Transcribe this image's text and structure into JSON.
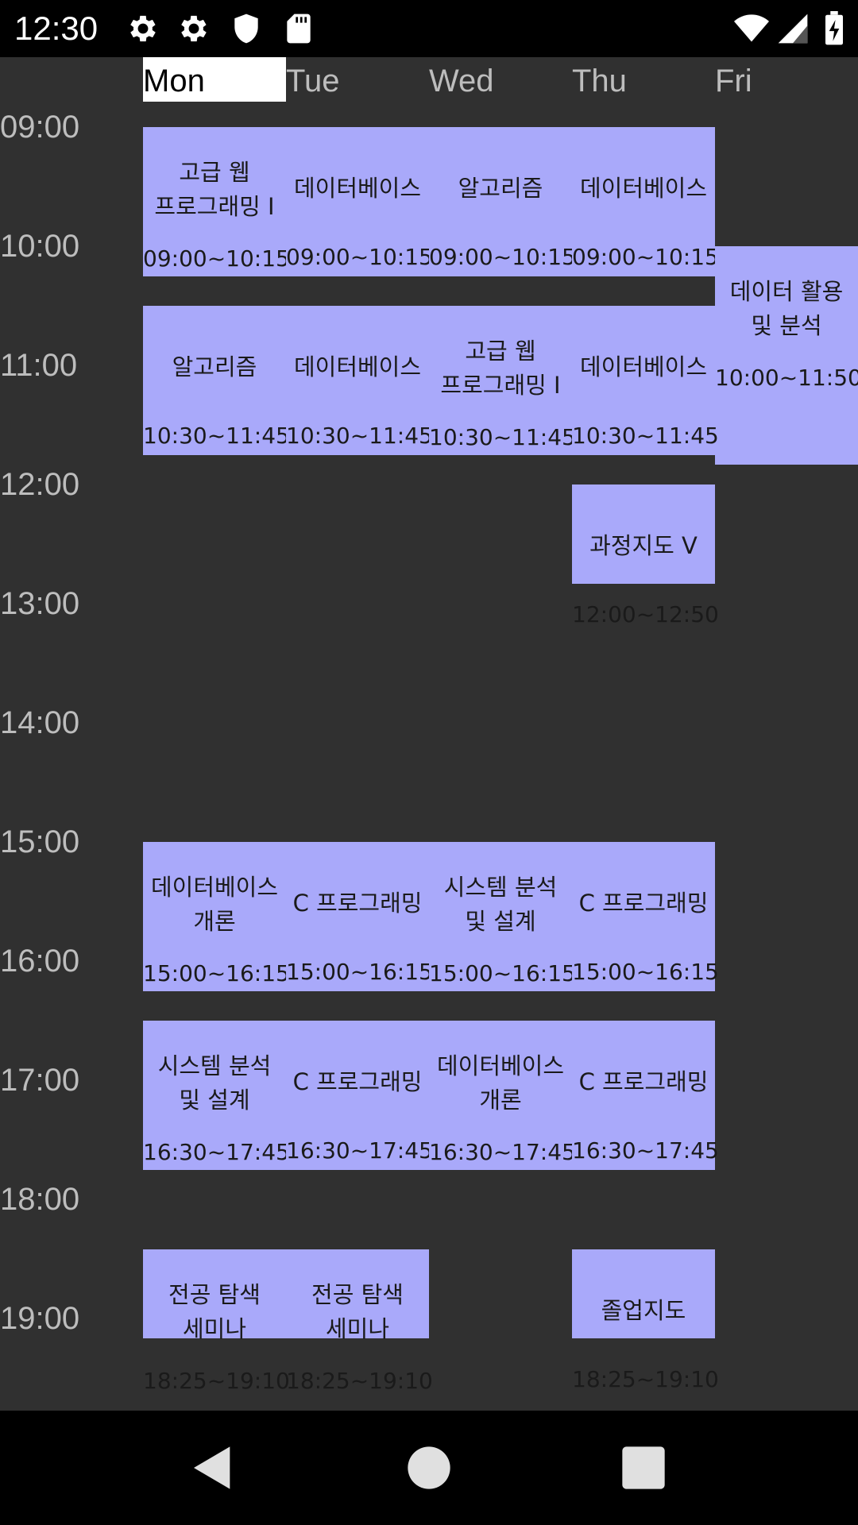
{
  "status_bar": {
    "time": "12:30",
    "left_icons": [
      "settings-icon",
      "settings-icon",
      "shield-icon",
      "sd-card-icon"
    ],
    "right_icons": [
      "wifi-icon",
      "cell-signal-icon",
      "battery-charging-icon"
    ]
  },
  "days": [
    "Mon",
    "Tue",
    "Wed",
    "Thu",
    "Fri"
  ],
  "selected_day": "Mon",
  "hours": [
    "09:00",
    "10:00",
    "11:00",
    "12:00",
    "13:00",
    "14:00",
    "15:00",
    "16:00",
    "17:00",
    "18:00",
    "19:00"
  ],
  "courses": [
    {
      "day": "Mon",
      "name": "고급 웹\n프로그래밍 I",
      "time": "09:00~10:15"
    },
    {
      "day": "Tue",
      "name": "데이터베이스",
      "time": "09:00~10:15"
    },
    {
      "day": "Wed",
      "name": "알고리즘",
      "time": "09:00~10:15"
    },
    {
      "day": "Thu",
      "name": "데이터베이스",
      "time": "09:00~10:15"
    },
    {
      "day": "Fri",
      "name": "데이터 활용\n및 분석",
      "time": "10:00~11:50"
    },
    {
      "day": "Mon",
      "name": "알고리즘",
      "time": "10:30~11:45"
    },
    {
      "day": "Tue",
      "name": "데이터베이스",
      "time": "10:30~11:45"
    },
    {
      "day": "Wed",
      "name": "고급 웹\n프로그래밍 I",
      "time": "10:30~11:45"
    },
    {
      "day": "Thu",
      "name": "데이터베이스",
      "time": "10:30~11:45"
    },
    {
      "day": "Thu",
      "name": "과정지도 V",
      "time": "12:00~12:50"
    },
    {
      "day": "Mon",
      "name": "데이터베이스\n개론",
      "time": "15:00~16:15"
    },
    {
      "day": "Tue",
      "name": "C 프로그래밍",
      "time": "15:00~16:15"
    },
    {
      "day": "Wed",
      "name": "시스템 분석\n및 설계",
      "time": "15:00~16:15"
    },
    {
      "day": "Thu",
      "name": "C 프로그래밍",
      "time": "15:00~16:15"
    },
    {
      "day": "Mon",
      "name": "시스템 분석\n및 설계",
      "time": "16:30~17:45"
    },
    {
      "day": "Tue",
      "name": "C 프로그래밍",
      "time": "16:30~17:45"
    },
    {
      "day": "Wed",
      "name": "데이터베이스\n개론",
      "time": "16:30~17:45"
    },
    {
      "day": "Thu",
      "name": "C 프로그래밍",
      "time": "16:30~17:45"
    },
    {
      "day": "Mon",
      "name": "전공 탐색\n세미나",
      "time": "18:25~19:10"
    },
    {
      "day": "Tue",
      "name": "전공 탐색\n세미나",
      "time": "18:25~19:10"
    },
    {
      "day": "Thu",
      "name": "졸업지도",
      "time": "18:25~19:10"
    }
  ],
  "nav_bar": {
    "icons": [
      "back-icon",
      "home-icon",
      "recents-icon"
    ]
  },
  "colors": {
    "background": "#303030",
    "course_block": "#a9a9fa",
    "bars": "#000000",
    "selected_day": "#ffffff"
  }
}
